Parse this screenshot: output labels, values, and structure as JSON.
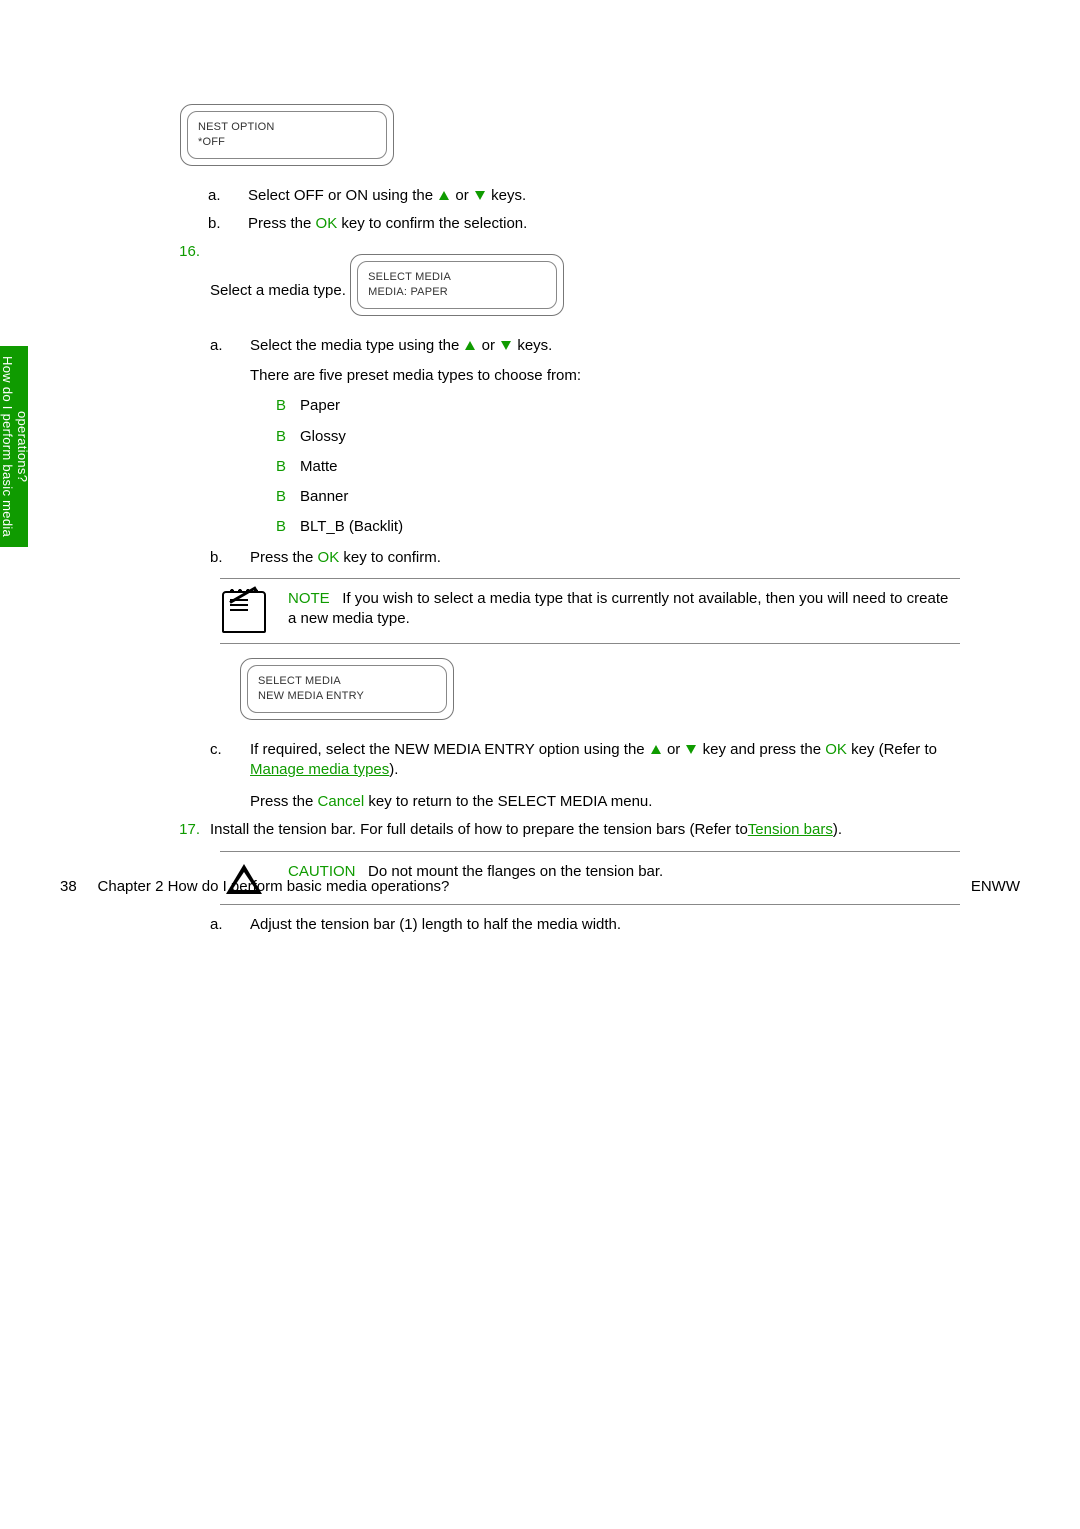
{
  "side_tab_line1": "How do I perform basic media",
  "side_tab_line2": "operations?",
  "display1": {
    "line1": "NEST OPTION",
    "line2": "*OFF"
  },
  "display2": {
    "line1": "SELECT MEDIA",
    "line2": "MEDIA: PAPER"
  },
  "display3": {
    "line1": "SELECT MEDIA",
    "line2": "NEW MEDIA ENTRY"
  },
  "step15": {
    "a_pre": "Select OFF or ON using the ",
    "a_or": " or ",
    "a_post": " keys.",
    "b_pre": "Press the ",
    "b_key": "OK",
    "b_post": " key to confirm the selection."
  },
  "step16": {
    "num": "16.",
    "text": "Select a media type.",
    "a_pre": "Select the media type using the ",
    "a_or": " or ",
    "a_post": " keys.",
    "a_detail": "There are five preset media types to choose from:",
    "items": {
      "0": "Paper",
      "1": "Glossy",
      "2": "Matte",
      "3": "Banner",
      "4": "BLT_B (Backlit)"
    },
    "b_pre": "Press the ",
    "b_key": "OK",
    "b_post": " key to confirm.",
    "note_label": "NOTE",
    "note_text": "If you wish to select a media type that is currently not available, then you will need to create a new media type.",
    "c_pre": "If required, select the NEW MEDIA ENTRY option using the ",
    "c_or": " or ",
    "c_mid": " key and press the ",
    "c_key": "OK",
    "c_refer_pre": " key (Refer to ",
    "c_link": "Manage media types",
    "c_tail": ").",
    "c_second_pre": "Press the ",
    "c_cancel": "Cancel",
    "c_second_post": " key to return to the SELECT MEDIA menu."
  },
  "step17": {
    "num": "17.",
    "text_pre": "Install the tension bar. For full details of how to prepare the tension bars (Refer to",
    "link": "Tension bars",
    "text_post": ").",
    "caution_label": "CAUTION",
    "caution_text": "Do not mount the flanges on the tension bar.",
    "a_text": "Adjust the tension bar (1) length to half the media width."
  },
  "footer": {
    "page": "38",
    "chapter": "Chapter 2   How do I perform basic media operations?",
    "right": "ENWW"
  }
}
